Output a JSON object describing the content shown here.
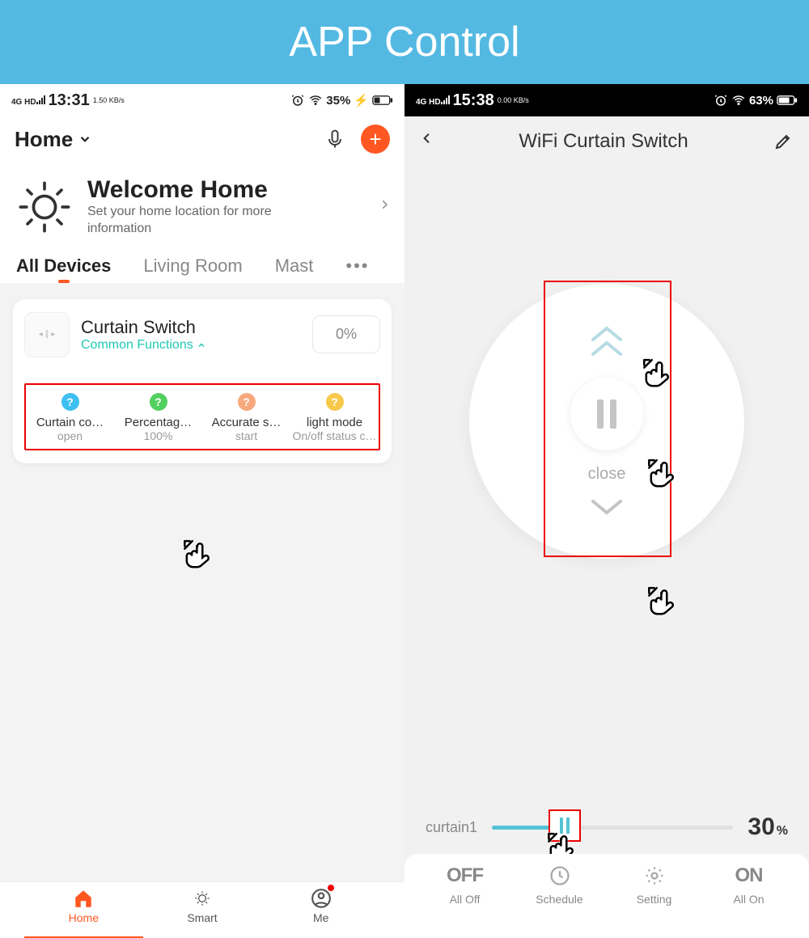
{
  "banner_title": "APP Control",
  "left": {
    "status": {
      "time": "13:31",
      "net": "4G HD",
      "speed": "1.50 KB/s",
      "battery": "35%"
    },
    "header": {
      "home_label": "Home"
    },
    "welcome": {
      "title": "Welcome Home",
      "subtitle": "Set your home location for more information"
    },
    "tabs": [
      "All Devices",
      "Living Room",
      "Mast"
    ],
    "card": {
      "title": "Curtain Switch",
      "subtitle": "Common Functions",
      "percent": "0%",
      "funcs": [
        {
          "label": "Curtain co…",
          "value": "open",
          "color": "#3ec0f0"
        },
        {
          "label": "Percentag…",
          "value": "100%",
          "color": "#51d05f"
        },
        {
          "label": "Accurate s…",
          "value": "start",
          "color": "#f7a87c"
        },
        {
          "label": "light mode",
          "value": "On/off status c…",
          "color": "#f7c84a"
        }
      ]
    },
    "bottomnav": [
      {
        "label": "Home",
        "active": true
      },
      {
        "label": "Smart"
      },
      {
        "label": "Me",
        "badge": true
      }
    ]
  },
  "right": {
    "status": {
      "time": "15:38",
      "net": "4G HD",
      "speed": "0.00 KB/s",
      "battery": "63%"
    },
    "title": "WiFi Curtain Switch",
    "circle": {
      "close_label": "close"
    },
    "slider": {
      "label": "curtain1",
      "value": "30",
      "unit": "%"
    },
    "bottom": [
      {
        "top": "OFF",
        "label": "All Off"
      },
      {
        "icon": "clock",
        "label": "Schedule"
      },
      {
        "icon": "gear",
        "label": "Setting"
      },
      {
        "top": "ON",
        "label": "All On"
      }
    ]
  }
}
